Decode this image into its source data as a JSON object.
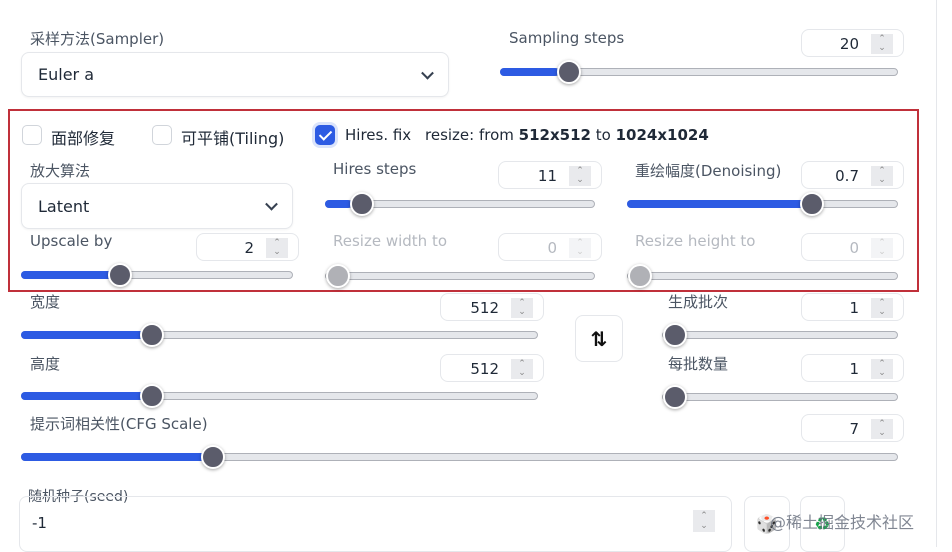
{
  "sampler": {
    "label": "采样方法(Sampler)",
    "value": "Euler a"
  },
  "sampling_steps": {
    "label": "Sampling steps",
    "value": "20",
    "fill": 0.15
  },
  "options": {
    "face_restore": {
      "label": "面部修复",
      "checked": false
    },
    "tiling": {
      "label": "可平铺(Tiling)",
      "checked": false
    },
    "hires_fix": {
      "label": "Hires. fix",
      "checked": true
    }
  },
  "resize_info": {
    "prefix": "resize: from ",
    "from": "512x512",
    "mid": " to ",
    "to": "1024x1024"
  },
  "hires": {
    "upscaler": {
      "label": "放大算法",
      "value": "Latent"
    },
    "hires_steps": {
      "label": "Hires steps",
      "value": "11",
      "fill": 0.1
    },
    "denoising": {
      "label": "重绘幅度(Denoising)",
      "value": "0.7",
      "fill": 0.7
    },
    "upscale_by": {
      "label": "Upscale by",
      "value": "2",
      "fill": 0.35
    },
    "resize_width": {
      "label": "Resize width to",
      "value": "0",
      "fill": 0
    },
    "resize_height": {
      "label": "Resize height to",
      "value": "0",
      "fill": 0
    }
  },
  "width": {
    "label": "宽度",
    "value": "512",
    "fill": 0.24
  },
  "height": {
    "label": "高度",
    "value": "512",
    "fill": 0.24
  },
  "batch_count": {
    "label": "生成批次",
    "value": "1",
    "fill": 0
  },
  "batch_size": {
    "label": "每批数量",
    "value": "1",
    "fill": 0
  },
  "cfg": {
    "label": "提示词相关性(CFG Scale)",
    "value": "7",
    "fill": 0.21
  },
  "seed": {
    "label": "随机种子(seed)",
    "value": "-1"
  },
  "watermark": "@稀土掘金技术社区",
  "colors": {
    "accent": "#2d5be3",
    "highlight_border": "#c0303a"
  }
}
